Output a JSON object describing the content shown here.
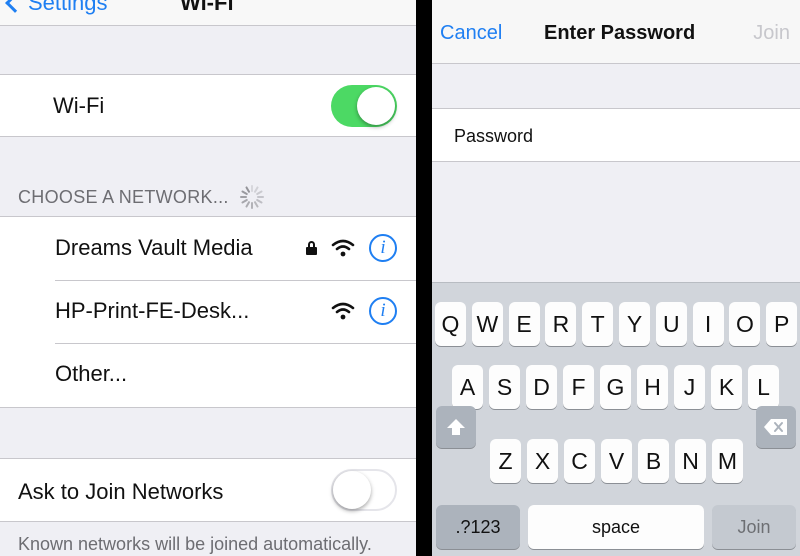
{
  "left": {
    "nav": {
      "back_label": "Settings",
      "title": "Wi-Fi"
    },
    "wifi": {
      "label": "Wi-Fi",
      "enabled": true
    },
    "section_header": "CHOOSE A NETWORK...",
    "networks": [
      {
        "name": "Dreams Vault Media",
        "secured": true
      },
      {
        "name": "HP-Print-FE-Desk...",
        "secured": false
      },
      {
        "name": "Other..."
      }
    ],
    "info_glyph": "i",
    "ask_to_join": {
      "label": "Ask to Join Networks",
      "enabled": false
    },
    "footer": "Known networks will be joined automatically."
  },
  "right": {
    "nav": {
      "cancel_label": "Cancel",
      "title": "Enter Password",
      "join_label": "Join"
    },
    "password": {
      "label": "Password",
      "value": "",
      "placeholder": ""
    },
    "keyboard": {
      "row1": [
        "Q",
        "W",
        "E",
        "R",
        "T",
        "Y",
        "U",
        "I",
        "O",
        "P"
      ],
      "row2": [
        "A",
        "S",
        "D",
        "F",
        "G",
        "H",
        "J",
        "K",
        "L"
      ],
      "row3": [
        "Z",
        "X",
        "C",
        "V",
        "B",
        "N",
        "M"
      ],
      "numbers_label": ".?123",
      "space_label": "space",
      "join_label": "Join"
    }
  },
  "colors": {
    "accent": "#1f7ff2",
    "toggle_on": "#4cd964",
    "background": "#efeff4"
  }
}
